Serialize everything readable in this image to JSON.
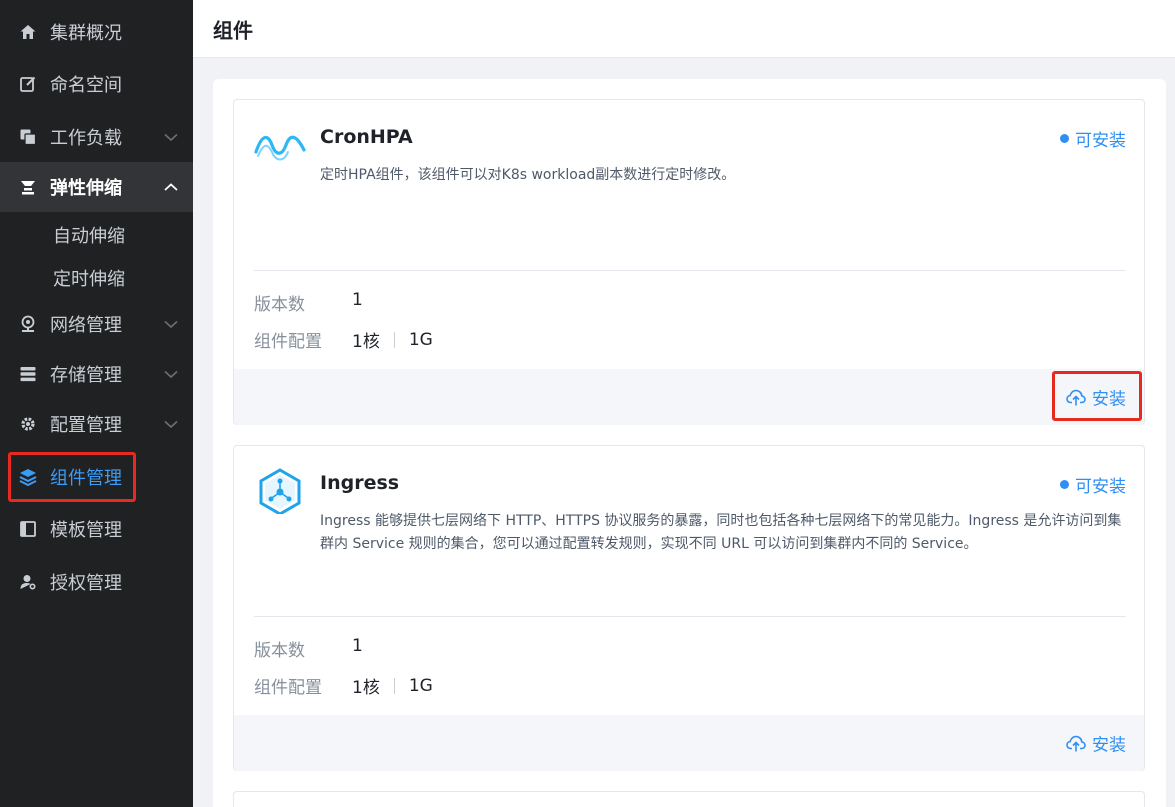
{
  "sidebar": {
    "items": [
      {
        "label": "集群概况",
        "icon": "home-icon"
      },
      {
        "label": "命名空间",
        "icon": "edit-icon"
      },
      {
        "label": "工作负载",
        "icon": "copy-icon"
      },
      {
        "label": "弹性伸缩",
        "icon": "scale-icon"
      },
      {
        "label": "网络管理",
        "icon": "network-icon"
      },
      {
        "label": "存储管理",
        "icon": "storage-icon"
      },
      {
        "label": "配置管理",
        "icon": "gear-icon"
      },
      {
        "label": "组件管理",
        "icon": "layers-icon"
      },
      {
        "label": "模板管理",
        "icon": "template-icon"
      },
      {
        "label": "授权管理",
        "icon": "user-key-icon"
      }
    ],
    "sub_items": [
      {
        "label": "自动伸缩"
      },
      {
        "label": "定时伸缩"
      }
    ],
    "active_color": "#3b9cf5"
  },
  "header": {
    "title": "组件"
  },
  "cards": [
    {
      "name": "CronHPA",
      "status": "可安装",
      "description": "定时HPA组件，该组件可以对K8s workload副本数进行定时修改。",
      "version_label": "版本数",
      "version_value": "1",
      "config_label": "组件配置",
      "cpu": "1核",
      "memory": "1G",
      "install_label": "安装",
      "logo_icon": "wave-icon"
    },
    {
      "name": "Ingress",
      "status": "可安装",
      "description": "Ingress 能够提供七层网络下 HTTP、HTTPS 协议服务的暴露，同时也包括各种七层网络下的常见能力。Ingress 是允许访问到集群内 Service 规则的集合，您可以通过配置转发规则，实现不同 URL 可以访问到集群内不同的 Service。",
      "version_label": "版本数",
      "version_value": "1",
      "config_label": "组件配置",
      "cpu": "1核",
      "memory": "1G",
      "install_label": "安装",
      "logo_icon": "hexagon-network-icon"
    }
  ],
  "colors": {
    "accent": "#2f8ff2",
    "highlight": "#e8291f",
    "sidebar_bg": "#202123"
  }
}
